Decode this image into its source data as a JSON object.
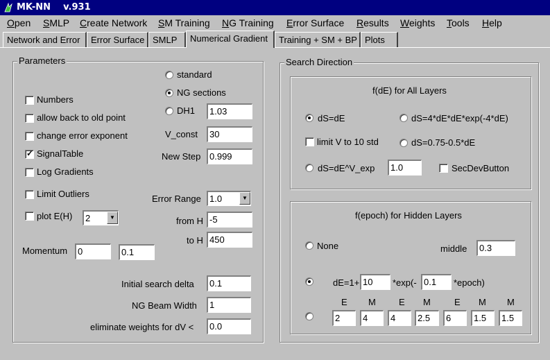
{
  "title": "MK-NN    v.931",
  "menu": [
    "Open",
    "SMLP",
    "Create Network",
    "SM Training",
    "NG Training",
    "Error Surface",
    "Results",
    "Weights",
    "Tools",
    "Help"
  ],
  "menu_underline": [
    "O",
    "S",
    "C",
    "S",
    "N",
    "E",
    "R",
    "W",
    "T",
    "H"
  ],
  "tabs": [
    "Network and Error",
    "Error Surface",
    "SMLP",
    "Numerical Gradient",
    "Training + SM + BP",
    "Plots"
  ],
  "params": {
    "title": "Parameters",
    "standard": "standard",
    "ng_sections": "NG sections",
    "dh1": "DH1",
    "dh1_value": "1.03",
    "numbers": "Numbers",
    "allow_back": "allow back to old point",
    "change_error": "change error exponent",
    "v_const": "V_const",
    "v_const_value": "30",
    "signal_table": "SignalTable",
    "new_step": "New Step",
    "new_step_value": "0.999",
    "log_gradients": "Log Gradients",
    "limit_outliers": "Limit Outliers",
    "error_range": "Error Range",
    "error_range_value": "1.0",
    "plot_eh": "plot E(H)",
    "plot_eh_value": "2",
    "from_h": "from H",
    "from_h_value": "-5",
    "to_h": "to H",
    "to_h_value": "450",
    "momentum": "Momentum",
    "momentum_value1": "0",
    "momentum_value2": "0.1",
    "initial_delta": "Initial search delta",
    "initial_delta_value": "0.1",
    "beam_width": "NG Beam Width",
    "beam_width_value": "1",
    "eliminate": "eliminate weights for dV <",
    "eliminate_value": "0.0"
  },
  "search": {
    "title": "Search Direction",
    "fde_title": "f(dE) for All Layers",
    "ds_de": "dS=dE",
    "ds_exp": "dS=4*dE*dE*exp(-4*dE)",
    "limit_v": "limit V to 10 std",
    "ds_075": "dS=0.75-0.5*dE",
    "ds_vexp": "dS=dE^V_exp",
    "ds_vexp_value": "1.0",
    "secdev": "SecDevButton",
    "fepoch_title": "f(epoch) for Hidden Layers",
    "none": "None",
    "middle": "middle",
    "middle_value": "0.3",
    "de_eq": "dE=1+",
    "de_value": "10",
    "exp_part": "*exp(-",
    "exp_value": "0.1",
    "epoch_part": "*epoch)",
    "em_headers": [
      "E",
      "M",
      "E",
      "M",
      "E",
      "M",
      "M"
    ],
    "em_values": [
      "2",
      "4",
      "4",
      "2.5",
      "6",
      "1.5",
      "1.5"
    ]
  }
}
